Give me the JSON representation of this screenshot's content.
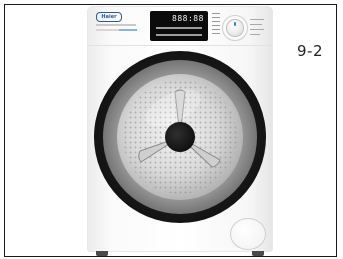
{
  "caption": "9-2",
  "product": {
    "brand_logo_text": "Haier",
    "display_readout": "888:88",
    "accent_color": "#2c5aa0",
    "knob_marker_color": "#3a7bd5"
  }
}
